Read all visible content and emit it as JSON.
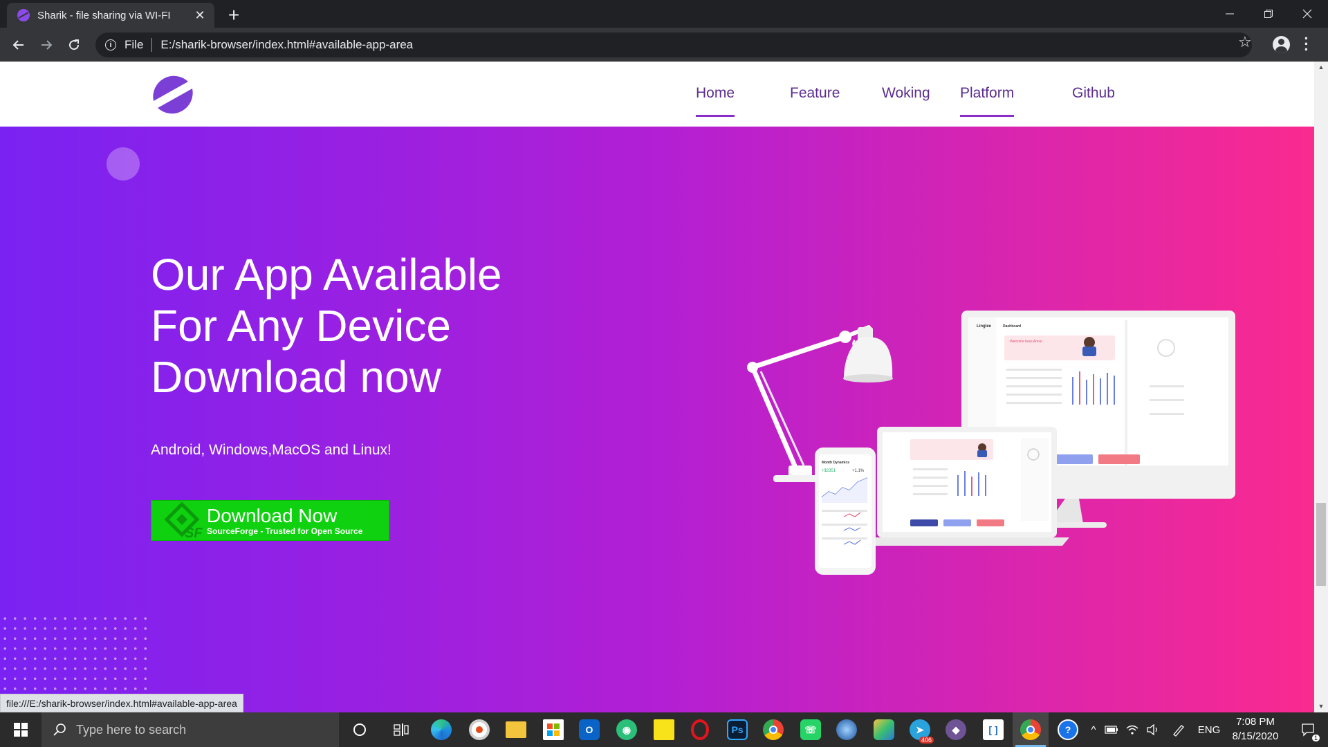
{
  "browser": {
    "tab_title": "Sharik - file sharing via WI-FI",
    "tab_close": "✕",
    "new_tab": "+",
    "scheme_label": "File",
    "url": "E:/sharik-browser/index.html#available-app-area",
    "status_url": "file:///E:/sharik-browser/index.html#available-app-area"
  },
  "nav": {
    "items": [
      {
        "label": "Home",
        "active": true
      },
      {
        "label": "Feature",
        "active": false
      },
      {
        "label": "Woking",
        "active": false
      },
      {
        "label": "Platform",
        "active": true
      },
      {
        "label": "Github",
        "active": false
      }
    ]
  },
  "hero": {
    "title_lines": [
      "Our App Available",
      "For Any Device",
      "Download now"
    ],
    "subtitle": "Android, Windows,MacOS and Linux!",
    "download_main": "Download Now",
    "download_sub": "SourceForge - Trusted for Open Source"
  },
  "illustration": {
    "dash_brand": "Linglee",
    "dash_title": "Dashboard",
    "welcome": "Welcome back Anna!",
    "phone_title": "Month Dynamics",
    "phone_value": "+$2351",
    "phone_change": "+1.1%"
  },
  "taskbar": {
    "search_placeholder": "Type here to search",
    "language": "ENG",
    "time": "7:08 PM",
    "date": "8/15/2020",
    "telegram_badge": "406",
    "notification_count": "1"
  },
  "colors": {
    "gradient_start": "#7a22f2",
    "gradient_mid": "#b21fd4",
    "gradient_end": "#fa2a8f",
    "nav_text": "#5b2d90",
    "nav_underline": "#8b2ec8",
    "download_green": "#10d10f"
  }
}
